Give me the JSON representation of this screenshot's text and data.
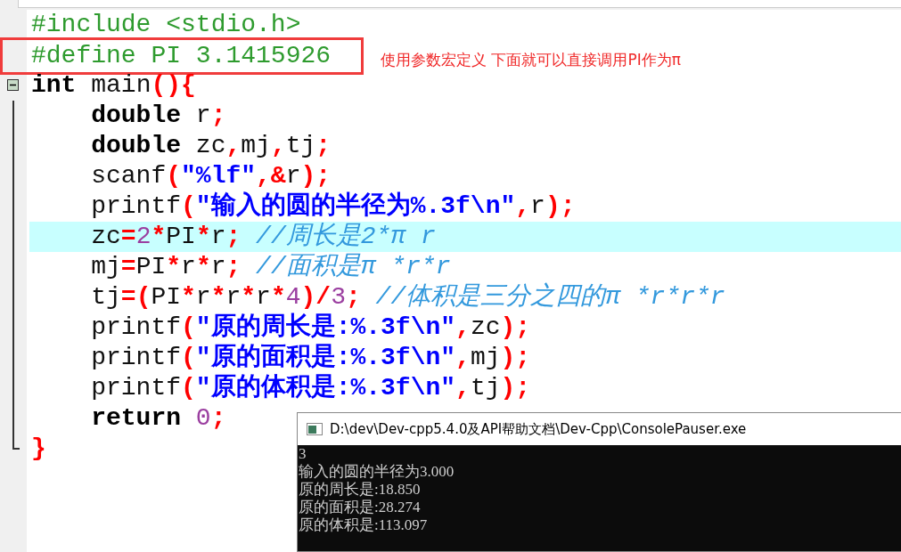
{
  "editor": {
    "lines": [
      {
        "highlighted": false,
        "boxed": false,
        "kind": "plain",
        "tokens": [
          {
            "kind": "preprocessor",
            "text": "#include <stdio.h>"
          }
        ]
      },
      {
        "highlighted": false,
        "boxed": true,
        "kind": "plain",
        "tokens": [
          {
            "kind": "preprocessor",
            "text": "#define PI 3.1415926"
          }
        ]
      },
      {
        "highlighted": false,
        "boxed": false,
        "kind": "fold_start",
        "tokens": [
          {
            "kind": "keyword",
            "text": "int"
          },
          {
            "kind": "plain",
            "text": " main"
          },
          {
            "kind": "symbol",
            "text": "(){"
          }
        ]
      },
      {
        "highlighted": false,
        "boxed": false,
        "kind": "fold_inside",
        "tokens": [
          {
            "kind": "keyword",
            "text": "    double"
          },
          {
            "kind": "plain",
            "text": " r"
          },
          {
            "kind": "symbol",
            "text": ";"
          }
        ]
      },
      {
        "highlighted": false,
        "boxed": false,
        "kind": "fold_inside",
        "tokens": [
          {
            "kind": "keyword",
            "text": "    double"
          },
          {
            "kind": "plain",
            "text": " zc"
          },
          {
            "kind": "symbol",
            "text": ","
          },
          {
            "kind": "plain",
            "text": "mj"
          },
          {
            "kind": "symbol",
            "text": ","
          },
          {
            "kind": "plain",
            "text": "tj"
          },
          {
            "kind": "symbol",
            "text": ";"
          }
        ]
      },
      {
        "highlighted": false,
        "boxed": false,
        "kind": "fold_inside",
        "tokens": [
          {
            "kind": "plain",
            "text": "    scanf"
          },
          {
            "kind": "symbol",
            "text": "("
          },
          {
            "kind": "string",
            "text": "\"%lf\""
          },
          {
            "kind": "symbol",
            "text": ",&"
          },
          {
            "kind": "plain",
            "text": "r"
          },
          {
            "kind": "symbol",
            "text": ");"
          }
        ]
      },
      {
        "highlighted": false,
        "boxed": false,
        "kind": "fold_inside",
        "tokens": [
          {
            "kind": "plain",
            "text": "    printf"
          },
          {
            "kind": "symbol",
            "text": "("
          },
          {
            "kind": "string",
            "text": "\"输入的圆的半径为%.3f\\n\""
          },
          {
            "kind": "symbol",
            "text": ","
          },
          {
            "kind": "plain",
            "text": "r"
          },
          {
            "kind": "symbol",
            "text": ");"
          }
        ]
      },
      {
        "highlighted": true,
        "boxed": false,
        "kind": "fold_inside",
        "tokens": [
          {
            "kind": "plain",
            "text": "    zc"
          },
          {
            "kind": "symbol",
            "text": "="
          },
          {
            "kind": "number",
            "text": "2"
          },
          {
            "kind": "symbol",
            "text": "*"
          },
          {
            "kind": "plain",
            "text": "PI"
          },
          {
            "kind": "symbol",
            "text": "*"
          },
          {
            "kind": "plain",
            "text": "r"
          },
          {
            "kind": "symbol",
            "text": ";"
          },
          {
            "kind": "comment",
            "text": " //周长是2*π r"
          }
        ]
      },
      {
        "highlighted": false,
        "boxed": false,
        "kind": "fold_inside",
        "tokens": [
          {
            "kind": "plain",
            "text": "    mj"
          },
          {
            "kind": "symbol",
            "text": "="
          },
          {
            "kind": "plain",
            "text": "PI"
          },
          {
            "kind": "symbol",
            "text": "*"
          },
          {
            "kind": "plain",
            "text": "r"
          },
          {
            "kind": "symbol",
            "text": "*"
          },
          {
            "kind": "plain",
            "text": "r"
          },
          {
            "kind": "symbol",
            "text": ";"
          },
          {
            "kind": "comment",
            "text": " //面积是π *r*r"
          }
        ]
      },
      {
        "highlighted": false,
        "boxed": false,
        "kind": "fold_inside",
        "tokens": [
          {
            "kind": "plain",
            "text": "    tj"
          },
          {
            "kind": "symbol",
            "text": "=("
          },
          {
            "kind": "plain",
            "text": "PI"
          },
          {
            "kind": "symbol",
            "text": "*"
          },
          {
            "kind": "plain",
            "text": "r"
          },
          {
            "kind": "symbol",
            "text": "*"
          },
          {
            "kind": "plain",
            "text": "r"
          },
          {
            "kind": "symbol",
            "text": "*"
          },
          {
            "kind": "plain",
            "text": "r"
          },
          {
            "kind": "symbol",
            "text": "*"
          },
          {
            "kind": "number",
            "text": "4"
          },
          {
            "kind": "symbol",
            "text": ")/"
          },
          {
            "kind": "number",
            "text": "3"
          },
          {
            "kind": "symbol",
            "text": ";"
          },
          {
            "kind": "comment",
            "text": " //体积是三分之四的π *r*r*r"
          }
        ]
      },
      {
        "highlighted": false,
        "boxed": false,
        "kind": "fold_inside",
        "tokens": [
          {
            "kind": "plain",
            "text": "    printf"
          },
          {
            "kind": "symbol",
            "text": "("
          },
          {
            "kind": "string",
            "text": "\"原的周长是:%.3f\\n\""
          },
          {
            "kind": "symbol",
            "text": ","
          },
          {
            "kind": "plain",
            "text": "zc"
          },
          {
            "kind": "symbol",
            "text": ");"
          }
        ]
      },
      {
        "highlighted": false,
        "boxed": false,
        "kind": "fold_inside",
        "tokens": [
          {
            "kind": "plain",
            "text": "    printf"
          },
          {
            "kind": "symbol",
            "text": "("
          },
          {
            "kind": "string",
            "text": "\"原的面积是:%.3f\\n\""
          },
          {
            "kind": "symbol",
            "text": ","
          },
          {
            "kind": "plain",
            "text": "mj"
          },
          {
            "kind": "symbol",
            "text": ");"
          }
        ]
      },
      {
        "highlighted": false,
        "boxed": false,
        "kind": "fold_inside",
        "tokens": [
          {
            "kind": "plain",
            "text": "    printf"
          },
          {
            "kind": "symbol",
            "text": "("
          },
          {
            "kind": "string",
            "text": "\"原的体积是:%.3f\\n\""
          },
          {
            "kind": "symbol",
            "text": ","
          },
          {
            "kind": "plain",
            "text": "tj"
          },
          {
            "kind": "symbol",
            "text": ");"
          }
        ]
      },
      {
        "highlighted": false,
        "boxed": false,
        "kind": "fold_inside",
        "tokens": [
          {
            "kind": "keyword",
            "text": "    return"
          },
          {
            "kind": "number",
            "text": " 0"
          },
          {
            "kind": "symbol",
            "text": ";"
          }
        ]
      },
      {
        "highlighted": false,
        "boxed": false,
        "kind": "fold_end",
        "tokens": [
          {
            "kind": "symbol",
            "text": "}"
          }
        ]
      }
    ]
  },
  "annotation": {
    "text": "使用参数宏定义  下面就可以直接调用PI作为π"
  },
  "console": {
    "title": "D:\\dev\\Dev-cpp5.4.0及API帮助文档\\Dev-Cpp\\ConsolePauser.exe",
    "output": [
      "3",
      "输入的圆的半径为3.000",
      "原的周长是:18.850",
      "原的面积是:28.274",
      "原的体积是:113.097"
    ]
  }
}
